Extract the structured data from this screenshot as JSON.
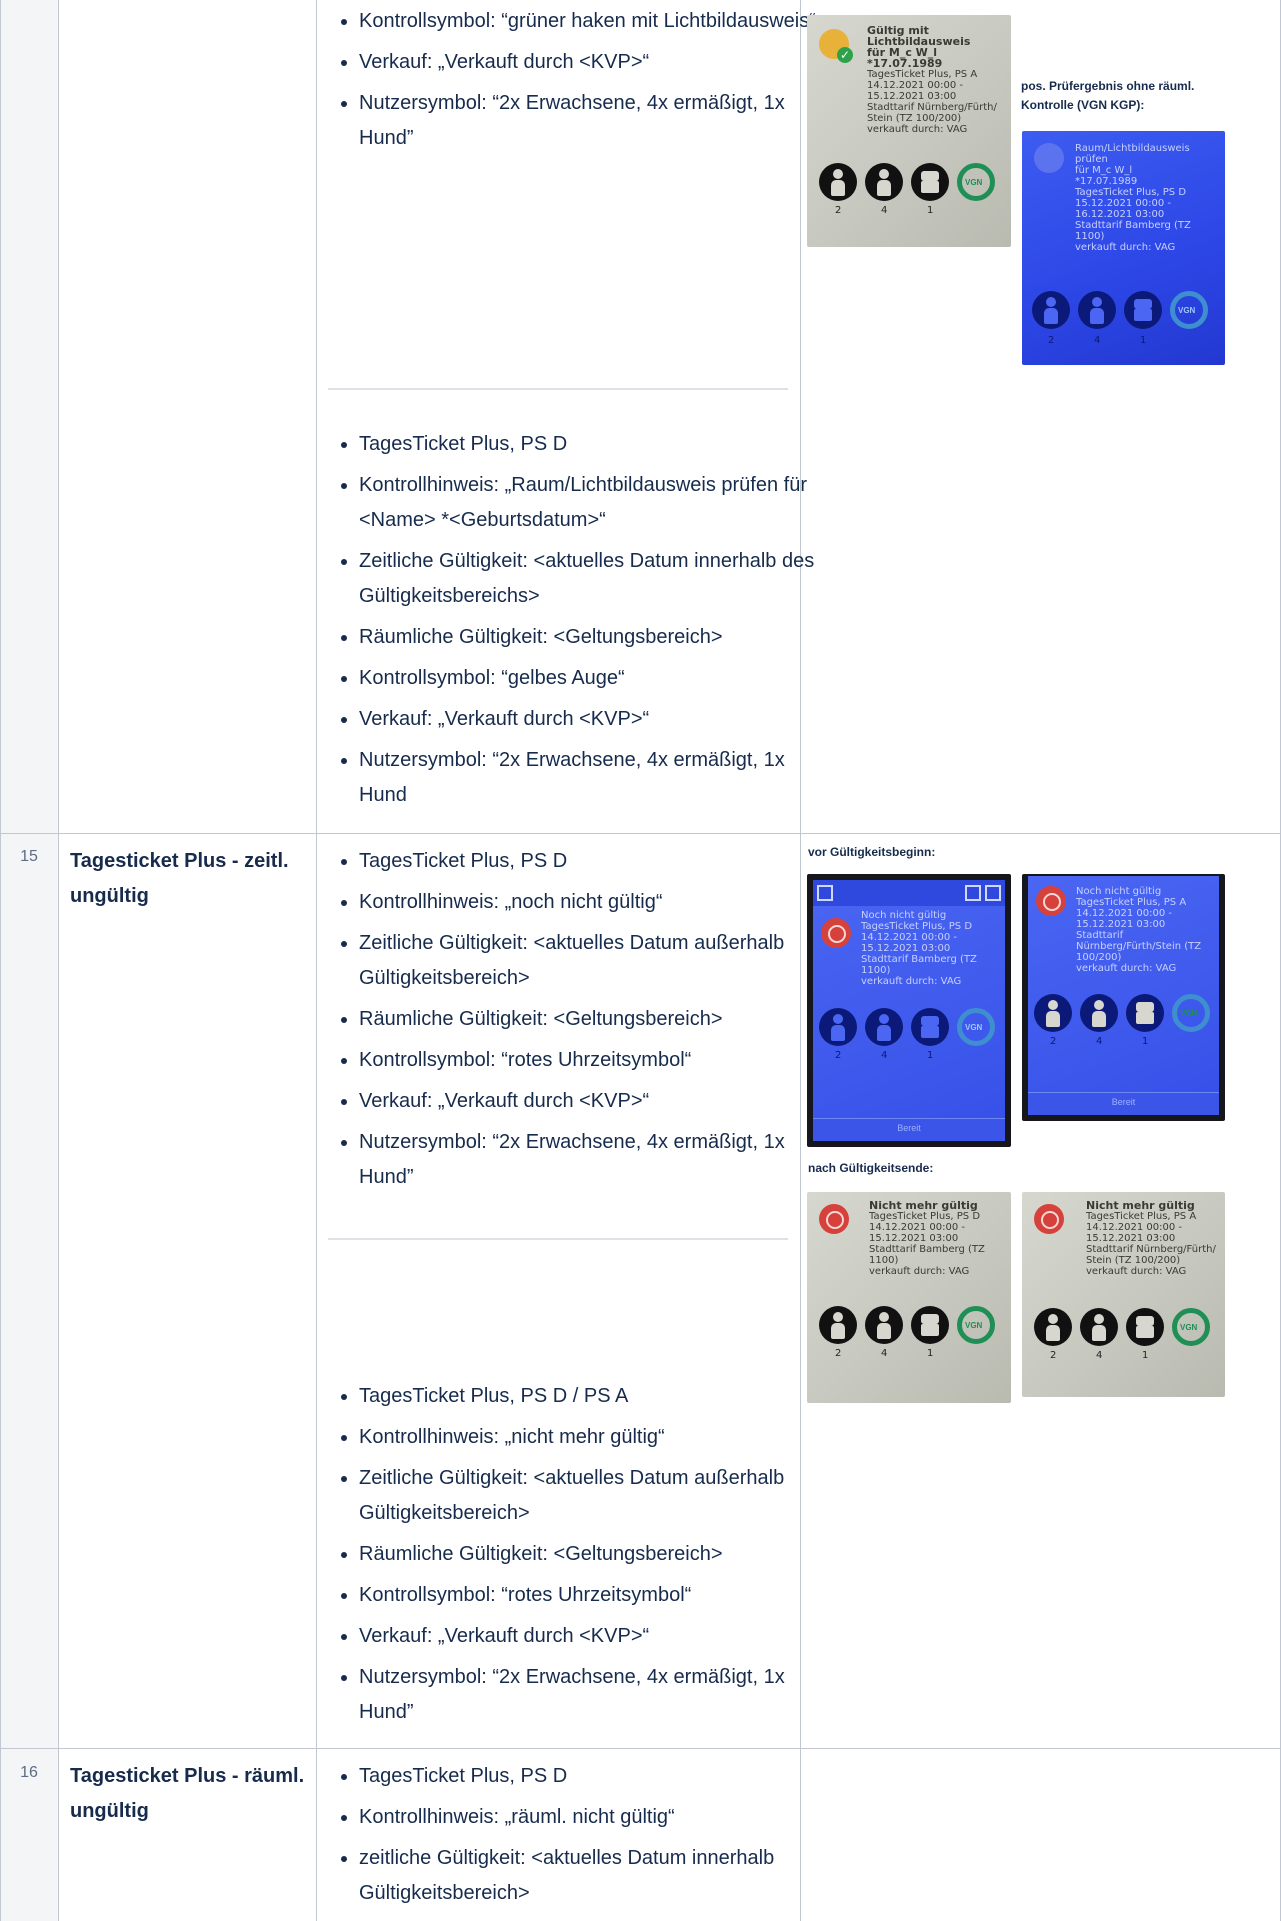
{
  "rows": [
    {
      "number": "",
      "title": "",
      "spec_a": [
        "Kontrollsymbol: “grüner haken mit Lichtbildausweis“",
        "Verkauf: „Verkauft durch <KVP>“",
        "Nutzersymbol: “2x Erwachsene, 4x ermäßigt, 1x Hund”"
      ],
      "spec_b": [
        "TagesTicket Plus, PS D",
        "Kontrollhinweis: „Raum/Lichtbildausweis prüfen für <Name> *<Geburtsdatum>“",
        "Zeitliche Gültigkeit: <aktuelles Datum innerhalb des Gültigkeitsbereichs>",
        "Räumliche Gültigkeit: <Geltungsbereich>",
        "Kontrollsymbol: “gelbes Auge“",
        "Verkauf: „Verkauft durch <KVP>“",
        "Nutzersymbol: “2x Erwachsene, 4x ermäßigt, 1x Hund"
      ],
      "caption": "pos. Prüfergebnis ohne räuml. Kontrolle (VGN KGP):",
      "shots": [
        {
          "lines": [
            "Gültig mit",
            "Lichtbildausweis",
            "für M_c W_l",
            "*17.07.1989",
            "TagesTicket Plus, PS A",
            "14.12.2021 00:00 -",
            "15.12.2021 03:00",
            "Stadttarif Nürnberg/Fürth/",
            "Stein (TZ 100/200)",
            "verkauft durch: VAG"
          ],
          "counts": [
            "2",
            "4",
            "1"
          ]
        },
        {
          "lines": [
            "Raum/Lichtbildausweis",
            "prüfen",
            "für M_c W_l",
            "*17.07.1989",
            "TagesTicket Plus, PS D",
            "15.12.2021 00:00 -",
            "16.12.2021 03:00",
            "Stadttarif Bamberg (TZ",
            "1100)",
            "verkauft durch: VAG"
          ],
          "counts": [
            "2",
            "4",
            "1"
          ]
        }
      ]
    },
    {
      "number": "15",
      "title": "Tagesticket Plus - zeitl. ungültig",
      "spec_a": [
        "TagesTicket Plus, PS D",
        "Kontrollhinweis: „noch nicht gültig“",
        "Zeitliche Gültigkeit: <aktuelles Datum außerhalb Gültigkeitsbereich>",
        "Räumliche Gültigkeit: <Geltungsbereich>",
        "Kontrollsymbol: “rotes Uhrzeitsymbol“",
        "Verkauf: „Verkauft durch <KVP>“",
        "Nutzersymbol: “2x Erwachsene, 4x ermäßigt, 1x Hund”"
      ],
      "spec_b": [
        "TagesTicket Plus, PS D / PS A",
        "Kontrollhinweis: „nicht mehr gültig“",
        "Zeitliche Gültigkeit: <aktuelles Datum außerhalb Gültigkeitsbereich>",
        "Räumliche Gültigkeit: <Geltungsbereich>",
        "Kontrollsymbol: “rotes Uhrzeitsymbol“",
        "Verkauf: „Verkauft durch <KVP>“",
        "Nutzersymbol: “2x Erwachsene, 4x ermäßigt, 1x Hund”"
      ],
      "caption_before": "vor Gültigkeitsbeginn:",
      "caption_after": "nach Gültigkeitsende:",
      "shots": [
        {
          "lines": [
            "Noch nicht gültig",
            "TagesTicket Plus, PS D",
            "14.12.2021 00:00 -",
            "15.12.2021 03:00",
            "Stadttarif Bamberg (TZ",
            "1100)",
            "verkauft durch: VAG"
          ],
          "counts": [
            "2",
            "4",
            "1"
          ],
          "footer": "Bereit"
        },
        {
          "lines": [
            "Noch nicht gültig",
            "TagesTicket Plus, PS A",
            "14.12.2021 00:00 -",
            "15.12.2021 03:00",
            "Stadttarif",
            "Nürnberg/Fürth/Stein (TZ",
            "100/200)",
            "verkauft durch: VAG"
          ],
          "counts": [
            "2",
            "4",
            "1"
          ],
          "footer": "Bereit"
        },
        {
          "lines": [
            "Nicht mehr gültig",
            "TagesTicket Plus, PS D",
            "14.12.2021 00:00 -",
            "15.12.2021 03:00",
            "Stadttarif Bamberg (TZ",
            "1100)",
            "verkauft durch: VAG"
          ],
          "counts": [
            "2",
            "4",
            "1"
          ]
        },
        {
          "lines": [
            "Nicht mehr gültig",
            "TagesTicket Plus, PS A",
            "14.12.2021 00:00 -",
            "15.12.2021 03:00",
            "Stadttarif Nürnberg/Fürth/",
            "Stein (TZ 100/200)",
            "verkauft durch: VAG"
          ],
          "counts": [
            "2",
            "4",
            "1"
          ]
        }
      ]
    },
    {
      "number": "16",
      "title": "Tagesticket Plus - räuml. ungültig",
      "spec_a": [
        "TagesTicket Plus, PS D",
        "Kontrollhinweis: „räuml. nicht gültig“",
        "zeitliche Gültigkeit: <aktuelles Datum innerhalb Gültigkeitsbereich>"
      ]
    }
  ],
  "colors": {
    "text": "#172b4d",
    "grid": "#c1c7d0",
    "number_column": "#f4f5f7",
    "screen_blue": "#3650e8",
    "status_red": "#d6413b",
    "status_yellow": "#e8b23a",
    "vgn_green": "#1f8f55"
  }
}
